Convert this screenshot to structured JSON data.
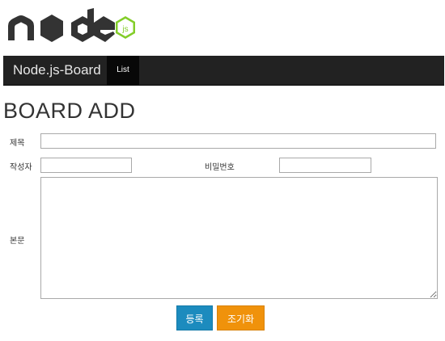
{
  "logo": {
    "alt": "node js logo"
  },
  "navbar": {
    "brand": "Node.js-Board",
    "items": [
      {
        "label": "List"
      }
    ]
  },
  "page": {
    "title": "BOARD ADD"
  },
  "form": {
    "title_label": "제목",
    "title_value": "",
    "author_label": "작성자",
    "author_value": "",
    "password_label": "비밀번호",
    "password_value": "",
    "content_label": "본문",
    "content_value": "",
    "submit_label": "등록",
    "reset_label": "조기화"
  },
  "colors": {
    "navbar_bg": "#222222",
    "active_nav_bg": "#080808",
    "submit_bg": "#1c8bbe",
    "reset_bg": "#f0920b",
    "node_green": "#83cd29",
    "logo_dark": "#333333"
  }
}
